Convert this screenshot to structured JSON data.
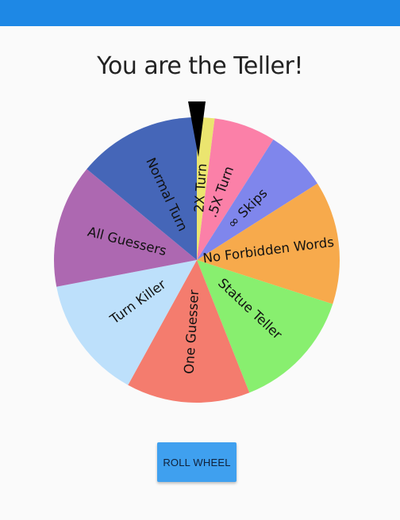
{
  "app": {
    "bar_color": "#1e88e5"
  },
  "header": {
    "title": "You are the Teller!"
  },
  "wheel": {
    "pointer_color": "#000000",
    "segments": [
      {
        "label": "2X Turn",
        "color": "#ebe56f",
        "share": 0.02
      },
      {
        "label": ".5X Turn",
        "color": "#fb80a8",
        "share": 0.07
      },
      {
        "label": "∞ Skips",
        "color": "#7f86ec",
        "share": 0.07
      },
      {
        "label": "No Forbidden Words",
        "color": "#f7aa4c",
        "share": 0.14
      },
      {
        "label": "Statue Teller",
        "color": "#88ef6f",
        "share": 0.14
      },
      {
        "label": "One Guesser",
        "color": "#f47c6e",
        "share": 0.14
      },
      {
        "label": "Turn Killer",
        "color": "#bde0fb",
        "share": 0.14
      },
      {
        "label": "All Guessers",
        "color": "#ad68b1",
        "share": 0.14
      },
      {
        "label": "Normal Turn",
        "color": "#4566b8",
        "share": 0.14
      }
    ]
  },
  "controls": {
    "roll_label": "ROLL WHEEL",
    "button_color": "#3fa0ef"
  }
}
